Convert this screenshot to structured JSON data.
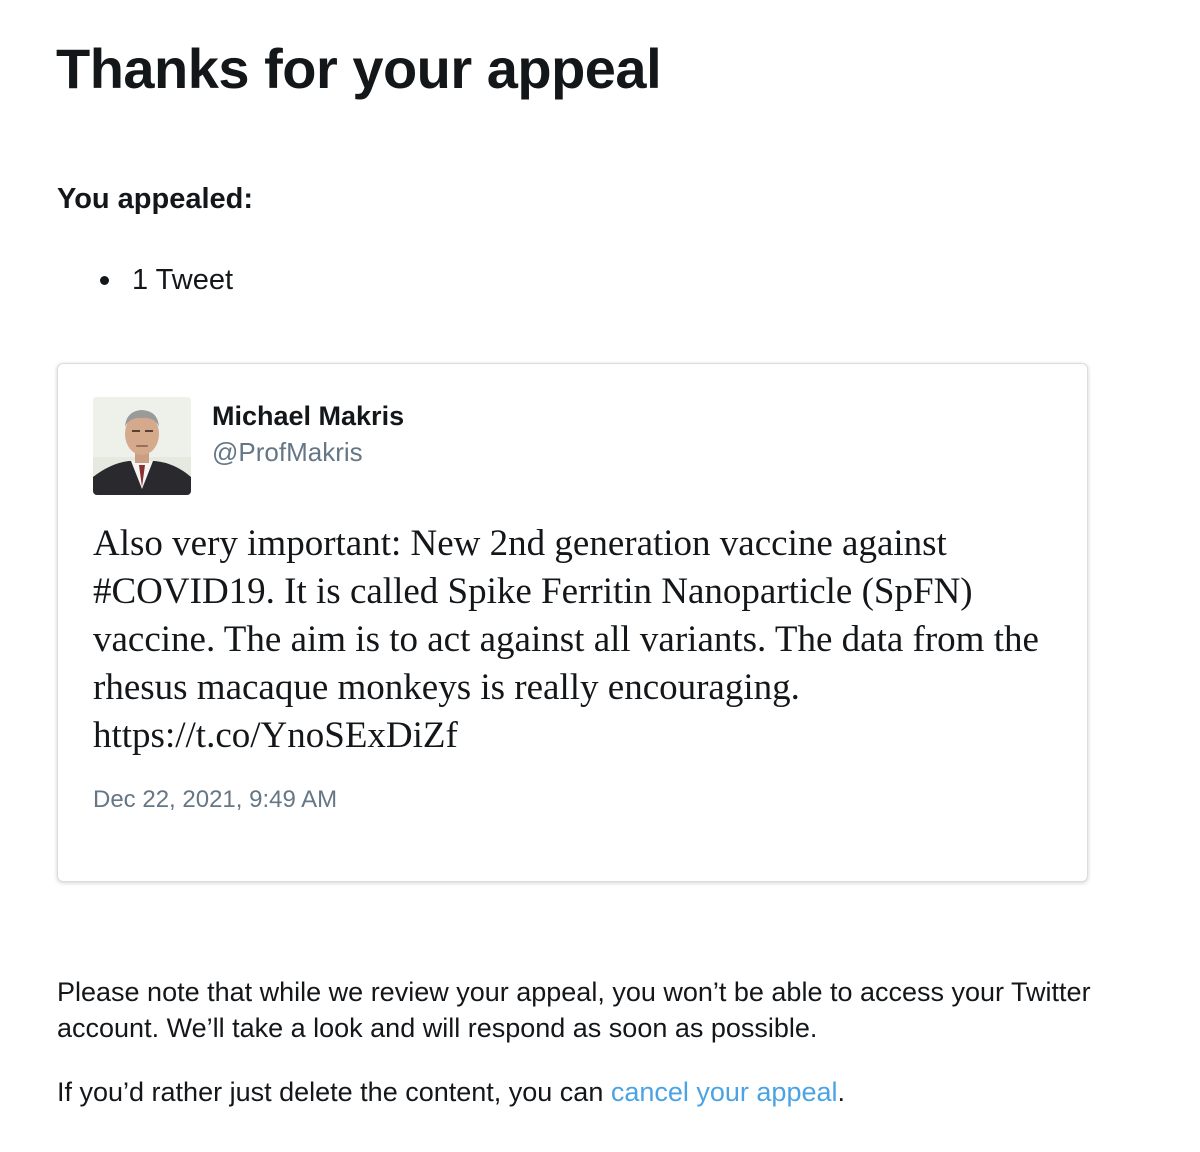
{
  "page": {
    "title": "Thanks for your appeal"
  },
  "appeal": {
    "heading": "You appealed:",
    "items": [
      "1 Tweet"
    ]
  },
  "tweet": {
    "author_name": "Michael Makris",
    "author_handle": "@ProfMakris",
    "avatar_icon": "profile-photo",
    "text": "Also very important: New 2nd generation vaccine against #COVID19. It is called Spike Ferritin Nanoparticle (SpFN) vaccine. The aim is to act against all variants. The data from the rhesus macaque monkeys is really encouraging. https://t.co/YnoSExDiZf",
    "date": "Dec 22, 2021, 9:49 AM"
  },
  "notice": {
    "text": "Please note that while we review your appeal, you won’t be able to access your Twitter account. We’ll take a look and will respond as soon as possible.",
    "cancel_prefix": "If you’d rather just delete the content, you can ",
    "cancel_link": "cancel your appeal",
    "cancel_suffix": "."
  },
  "colors": {
    "text": "#14171a",
    "secondary_text": "#657786",
    "link": "#4ba3e3",
    "card_border": "#d8dde1"
  }
}
